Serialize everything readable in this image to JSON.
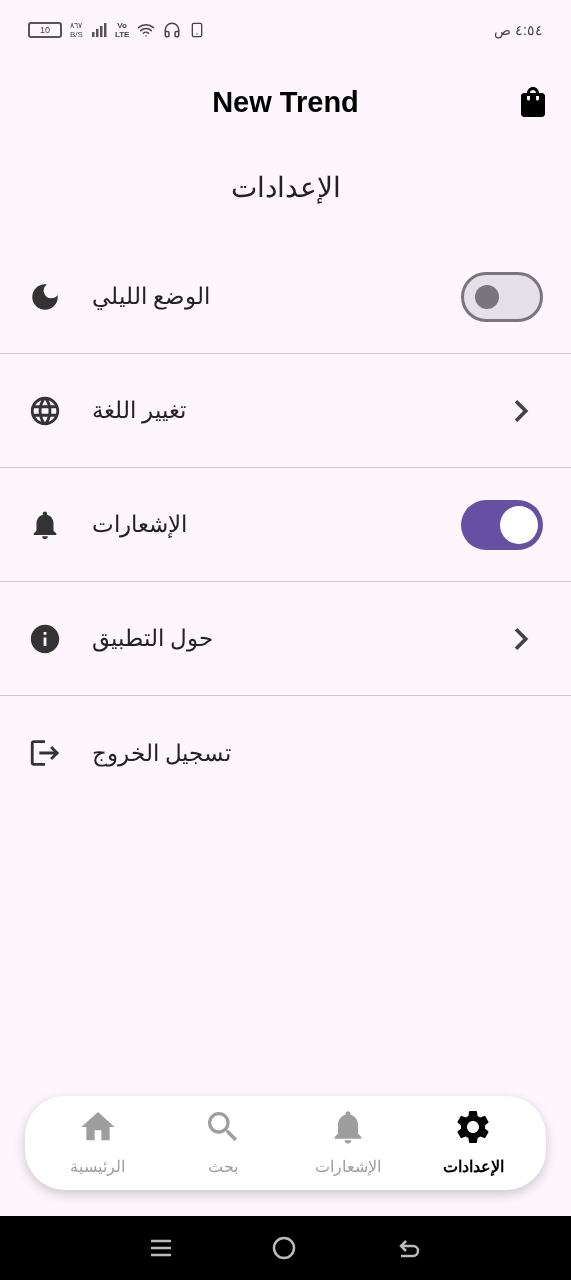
{
  "status_bar": {
    "battery": "10",
    "speed": "٨٦٧",
    "speed_unit": "B/S",
    "network_top": "Vo",
    "network_bottom": "LTE",
    "time": "٤:٥٤ ص"
  },
  "app_bar": {
    "title": "New Trend"
  },
  "page_title": "الإعدادات",
  "settings": [
    {
      "kind": "switch",
      "label": "الوضع الليلي",
      "on": false
    },
    {
      "kind": "link",
      "label": "تغيير اللغة"
    },
    {
      "kind": "switch",
      "label": "الإشعارات",
      "on": true
    },
    {
      "kind": "link",
      "label": "حول التطبيق"
    },
    {
      "kind": "plain",
      "label": "تسجيل الخروج"
    }
  ],
  "bottom_nav": [
    {
      "label": "الإعدادات",
      "selected": true
    },
    {
      "label": "الإشعارات",
      "selected": false
    },
    {
      "label": "بحث",
      "selected": false
    },
    {
      "label": "الرئيسية",
      "selected": false
    }
  ]
}
